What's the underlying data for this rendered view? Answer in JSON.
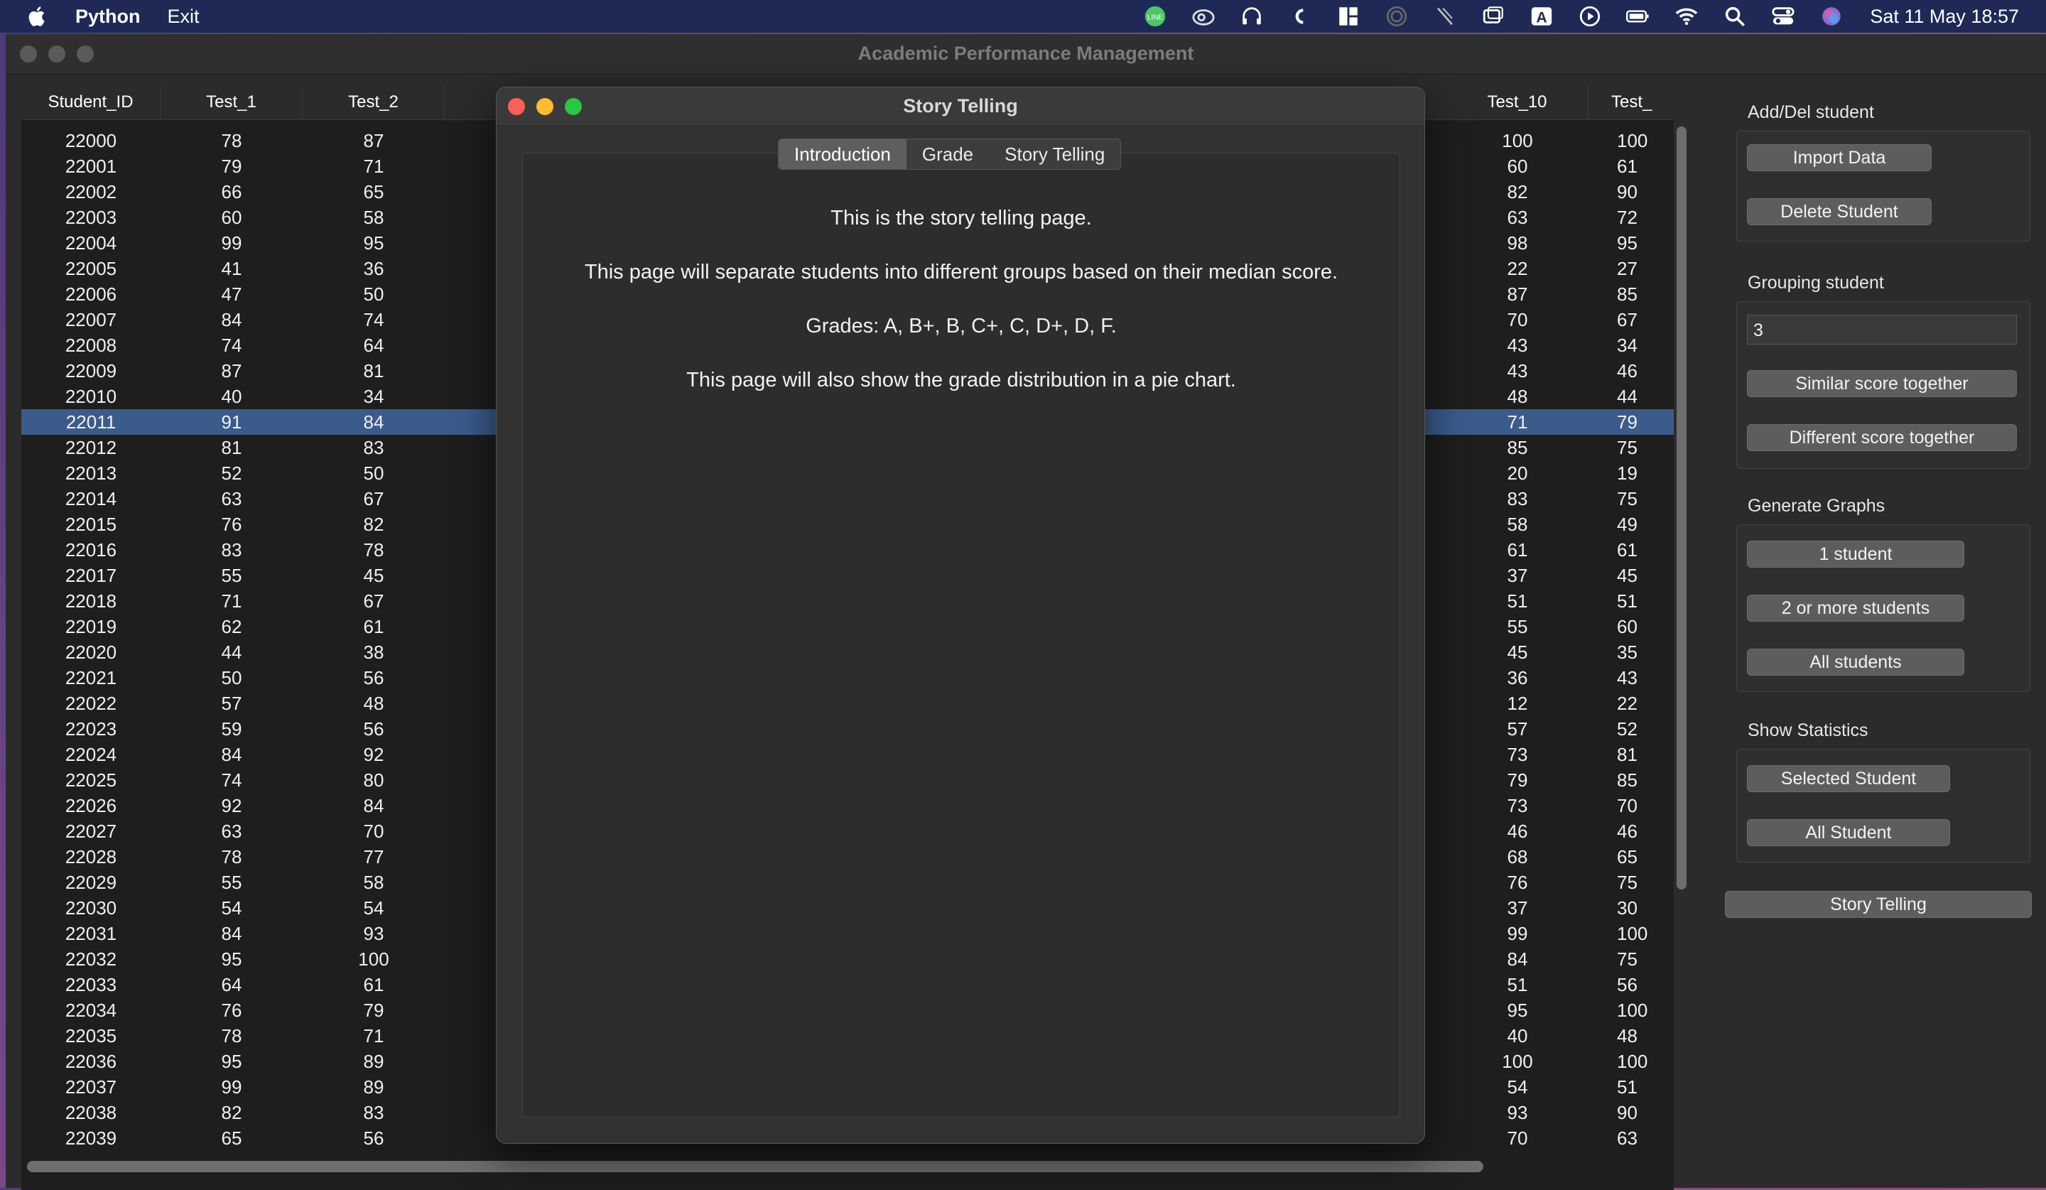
{
  "menubar": {
    "app_name": "Python",
    "menu_exit": "Exit",
    "clock": "Sat 11 May  18:57",
    "status_icons": [
      "line-icon",
      "creative-cloud-icon",
      "headphones-icon",
      "app-icon",
      "layout-icon",
      "airdrop-icon",
      "pen-icon",
      "display-icon",
      "input-a-icon",
      "play-icon",
      "battery-icon",
      "wifi-icon",
      "search-icon",
      "control-center-icon",
      "siri-icon"
    ],
    "input_label": "A"
  },
  "window": {
    "title": "Academic Performance Management"
  },
  "table": {
    "left_headers": [
      "Student_ID",
      "Test_1",
      "Test_2"
    ],
    "right_headers": [
      "Test_10",
      "Test_"
    ],
    "selected_index": 11,
    "rows": [
      [
        "22000",
        "78",
        "87",
        "100",
        "100"
      ],
      [
        "22001",
        "79",
        "71",
        "60",
        "61"
      ],
      [
        "22002",
        "66",
        "65",
        "82",
        "90"
      ],
      [
        "22003",
        "60",
        "58",
        "63",
        "72"
      ],
      [
        "22004",
        "99",
        "95",
        "98",
        "95"
      ],
      [
        "22005",
        "41",
        "36",
        "22",
        "27"
      ],
      [
        "22006",
        "47",
        "50",
        "87",
        "85"
      ],
      [
        "22007",
        "84",
        "74",
        "70",
        "67"
      ],
      [
        "22008",
        "74",
        "64",
        "43",
        "34"
      ],
      [
        "22009",
        "87",
        "81",
        "43",
        "46"
      ],
      [
        "22010",
        "40",
        "34",
        "48",
        "44"
      ],
      [
        "22011",
        "91",
        "84",
        "71",
        "79"
      ],
      [
        "22012",
        "81",
        "83",
        "85",
        "75"
      ],
      [
        "22013",
        "52",
        "50",
        "20",
        "19"
      ],
      [
        "22014",
        "63",
        "67",
        "83",
        "75"
      ],
      [
        "22015",
        "76",
        "82",
        "58",
        "49"
      ],
      [
        "22016",
        "83",
        "78",
        "61",
        "61"
      ],
      [
        "22017",
        "55",
        "45",
        "37",
        "45"
      ],
      [
        "22018",
        "71",
        "67",
        "51",
        "51"
      ],
      [
        "22019",
        "62",
        "61",
        "55",
        "60"
      ],
      [
        "22020",
        "44",
        "38",
        "45",
        "35"
      ],
      [
        "22021",
        "50",
        "56",
        "36",
        "43"
      ],
      [
        "22022",
        "57",
        "48",
        "12",
        "22"
      ],
      [
        "22023",
        "59",
        "56",
        "57",
        "52"
      ],
      [
        "22024",
        "84",
        "92",
        "73",
        "81"
      ],
      [
        "22025",
        "74",
        "80",
        "79",
        "85"
      ],
      [
        "22026",
        "92",
        "84",
        "73",
        "70"
      ],
      [
        "22027",
        "63",
        "70",
        "46",
        "46"
      ],
      [
        "22028",
        "78",
        "77",
        "68",
        "65"
      ],
      [
        "22029",
        "55",
        "58",
        "76",
        "75"
      ],
      [
        "22030",
        "54",
        "54",
        "37",
        "30"
      ],
      [
        "22031",
        "84",
        "93",
        "99",
        "100"
      ],
      [
        "22032",
        "95",
        "100",
        "84",
        "75"
      ],
      [
        "22033",
        "64",
        "61",
        "51",
        "56"
      ],
      [
        "22034",
        "76",
        "79",
        "95",
        "100"
      ],
      [
        "22035",
        "78",
        "71",
        "40",
        "48"
      ],
      [
        "22036",
        "95",
        "89",
        "100",
        "100"
      ],
      [
        "22037",
        "99",
        "89",
        "54",
        "51"
      ],
      [
        "22038",
        "82",
        "83",
        "93",
        "90"
      ],
      [
        "22039",
        "65",
        "56",
        "70",
        "63"
      ]
    ]
  },
  "side": {
    "add_del_title": "Add/Del student",
    "import_label": "Import Data",
    "delete_label": "Delete Student",
    "grouping_title": "Grouping student",
    "group_count_value": "3",
    "similar_label": "Similar score together",
    "different_label": "Different score together",
    "graphs_title": "Generate Graphs",
    "one_student_label": "1 student",
    "two_more_label": "2 or more students",
    "all_students_label": "All students",
    "stats_title": "Show Statistics",
    "selected_student_label": "Selected Student",
    "all_student_label": "All Student",
    "story_telling_label": "Story Telling"
  },
  "dialog": {
    "title": "Story Telling",
    "tabs": [
      "Introduction",
      "Grade",
      "Story Telling"
    ],
    "active_tab": "Introduction",
    "lines": [
      "This is the story telling page.",
      "This page will separate students into different groups based on their median score.",
      "Grades: A, B+, B, C+, C, D+, D, F.",
      "This page will also show the grade distribution in a pie chart."
    ]
  }
}
